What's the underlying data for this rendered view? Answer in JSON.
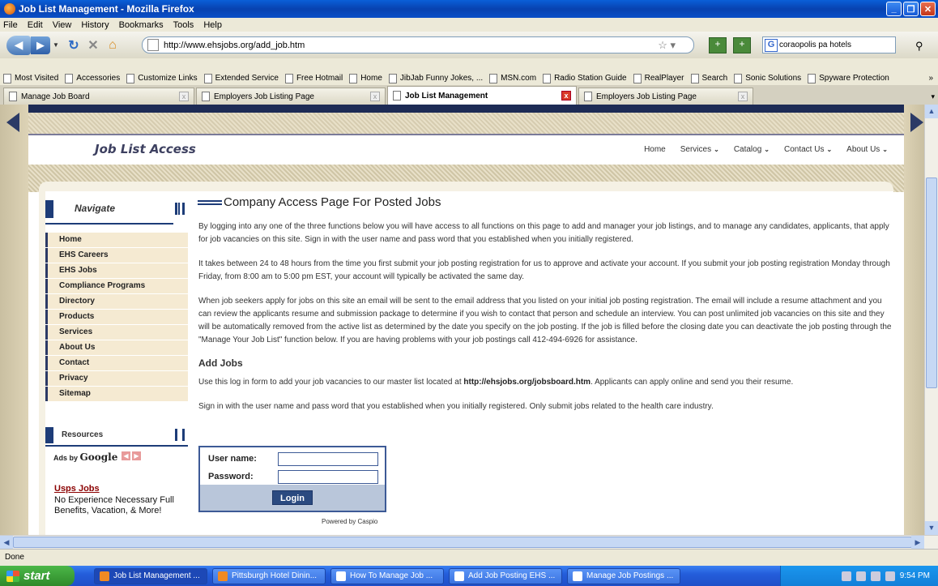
{
  "window": {
    "title": "Job List Management - Mozilla Firefox"
  },
  "menu": [
    "File",
    "Edit",
    "View",
    "History",
    "Bookmarks",
    "Tools",
    "Help"
  ],
  "address": {
    "url": "http://www.ehsjobs.org/add_job.htm"
  },
  "search": {
    "value": "coraopolis pa hotels"
  },
  "bookmarks": [
    "Most Visited",
    "Accessories",
    "Customize Links",
    "Extended Service",
    "Free Hotmail",
    "Home",
    "JibJab Funny Jokes, ...",
    "MSN.com",
    "Radio Station Guide",
    "RealPlayer",
    "Search",
    "Sonic Solutions",
    "Spyware Protection"
  ],
  "bookmarks_more": "»",
  "tabs": [
    {
      "label": "Manage Job Board",
      "active": false
    },
    {
      "label": "Employers Job Listing Page",
      "active": false
    },
    {
      "label": "Job List Management",
      "active": true
    },
    {
      "label": "Employers Job Listing Page",
      "active": false
    }
  ],
  "site": {
    "title": "Job List Access",
    "topnav": [
      "Home",
      "Services",
      "Catalog",
      "Contact Us",
      "About Us"
    ]
  },
  "sidebar": {
    "heading": "Navigate",
    "items": [
      "Home",
      "EHS Careers",
      "EHS Jobs",
      "Compliance Programs",
      "Directory",
      "Products",
      "Services",
      "About Us",
      "Contact",
      "Privacy",
      "Sitemap"
    ],
    "resources": "Resources",
    "ads_by": "Ads by",
    "ads_google": "Google",
    "ad_link": "Usps Jobs",
    "ad_text": "No Experience Necessary Full Benefits, Vacation, & More!"
  },
  "main": {
    "title": "Company Access Page For Posted Jobs",
    "p1": "By logging into any one of the three functions below you will have access to all functions on this page to add and manager your job listings, and to manage any candidates, applicants, that apply for job vacancies on this site. Sign in with the user name and pass word that you established when you initially registered.",
    "p2": "It takes between 24 to 48 hours from the time you first submit your job posting registration for us to approve and activate your account. If you submit your job posting registration Monday through Friday, from 8:00 am to 5:00 pm EST, your account will typically be activated the same day.",
    "p3": "When job seekers apply for jobs on this site an email will be sent to the email address that you listed on your initial job posting registration. The email will include a resume attachment and you can review the applicants resume and submission package to determine if you wish to contact that person and schedule an interview. You can post unlimited job vacancies on this site and they will be automatically removed from the active list as determined by the date you specify on the job posting. If the job is filled before the closing date you can deactivate the job posting through the \"Manage Your Job List\" function below. If you are having problems with your job postings call 412-494-6926 for assistance.",
    "add_heading": "Add Jobs",
    "p4_pre": "Use this log in form to add your job vacancies to our master list located at ",
    "p4_url": "http://ehsjobs.org/jobsboard.htm",
    "p4_post": ". Applicants can apply online and send you their resume.",
    "p5": "Sign in with the user name and pass word that you established when you initially registered. Only submit jobs related to the health care industry."
  },
  "login": {
    "username_label": "User name:",
    "password_label": "Password:",
    "button": "Login",
    "powered": "Powered by Caspio"
  },
  "status": "Done",
  "taskbar": {
    "start": "start",
    "items": [
      "Job List Management ...",
      "Pittsburgh Hotel Dinin...",
      "How To Manage Job ...",
      "Add Job Posting EHS ...",
      "Manage Job Postings ..."
    ],
    "clock": "9:54 PM"
  }
}
